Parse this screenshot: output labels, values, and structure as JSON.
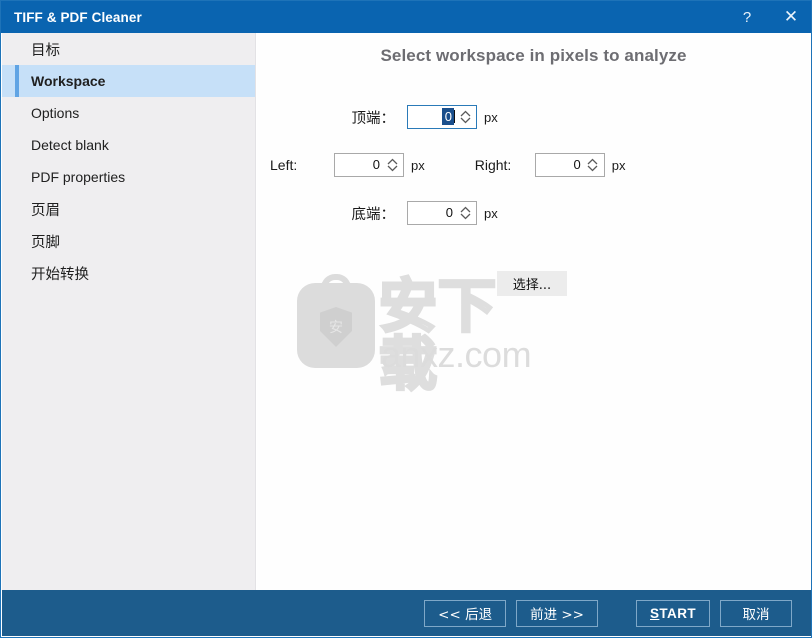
{
  "window": {
    "title": "TIFF & PDF Cleaner",
    "help_icon": "?",
    "close_icon": "✕",
    "accent_blue": "#0a64b0",
    "footer_blue": "#1d5c8c",
    "selection_blue": "#c6e0f8"
  },
  "sidebar": {
    "items": [
      {
        "label": "目标",
        "selected": false
      },
      {
        "label": "Workspace",
        "selected": true
      },
      {
        "label": "Options",
        "selected": false
      },
      {
        "label": "Detect blank",
        "selected": false
      },
      {
        "label": "PDF properties",
        "selected": false
      },
      {
        "label": "页眉",
        "selected": false
      },
      {
        "label": "页脚",
        "selected": false
      },
      {
        "label": "开始转换",
        "selected": false
      }
    ]
  },
  "main": {
    "heading": "Select workspace in pixels to analyze",
    "fields": {
      "top": {
        "label": "顶端：",
        "value": "0",
        "unit": "px",
        "focused": true
      },
      "left": {
        "label": "Left:",
        "value": "0",
        "unit": "px",
        "focused": false
      },
      "right": {
        "label": "Right:",
        "value": "0",
        "unit": "px",
        "focused": false
      },
      "bottom": {
        "label": "底端：",
        "value": "0",
        "unit": "px",
        "focused": false
      }
    },
    "select_button": "选择..."
  },
  "watermark": {
    "logo_char": "安",
    "brand_cn": "安下载",
    "brand_url": "anxz.com"
  },
  "footer": {
    "back": "<< 后退",
    "next": "前进 >>",
    "start": "START",
    "start_accel": "S",
    "start_rest": "TART",
    "cancel": "取消"
  }
}
